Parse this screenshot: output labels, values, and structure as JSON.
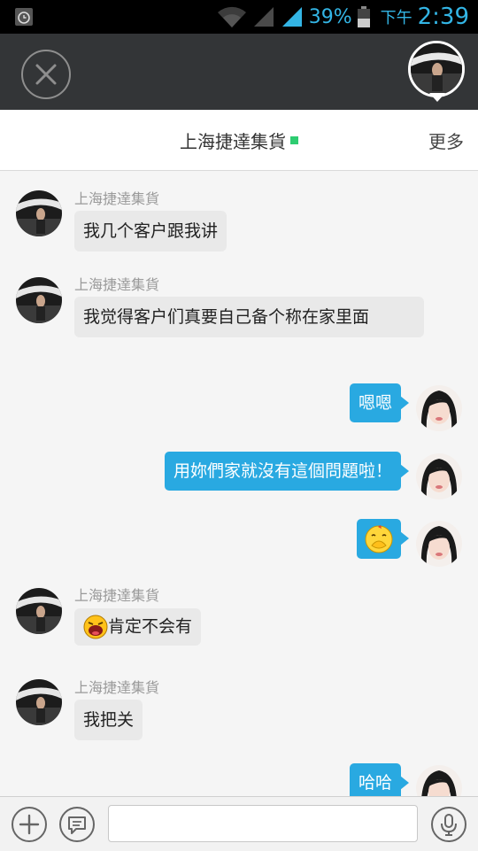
{
  "status_bar": {
    "battery_percent": "39%",
    "ampm": "下午",
    "time": "2:39"
  },
  "header": {
    "title": "上海捷達集貨",
    "more_label": "更多"
  },
  "messages": [
    {
      "side": "in",
      "sender": "上海捷達集貨",
      "text": "我几个客户跟我讲"
    },
    {
      "side": "in",
      "sender": "上海捷達集貨",
      "text": "我觉得客户们真要自己备个称在家里面"
    },
    {
      "side": "out",
      "text": "嗯嗯"
    },
    {
      "side": "out",
      "text": "用妳們家就沒有這個問題啦！"
    },
    {
      "side": "out",
      "emoji": "covering-mouth-emoji"
    },
    {
      "side": "in",
      "sender": "上海捷達集貨",
      "emoji": "shouting-emoji",
      "text": "肯定不会有"
    },
    {
      "side": "in",
      "sender": "上海捷達集貨",
      "text": "我把关"
    },
    {
      "side": "out",
      "text": "哈哈"
    }
  ],
  "input": {
    "value": ""
  },
  "colors": {
    "accent": "#29a9e1",
    "topbar": "#333537",
    "online": "#2ecc71"
  }
}
